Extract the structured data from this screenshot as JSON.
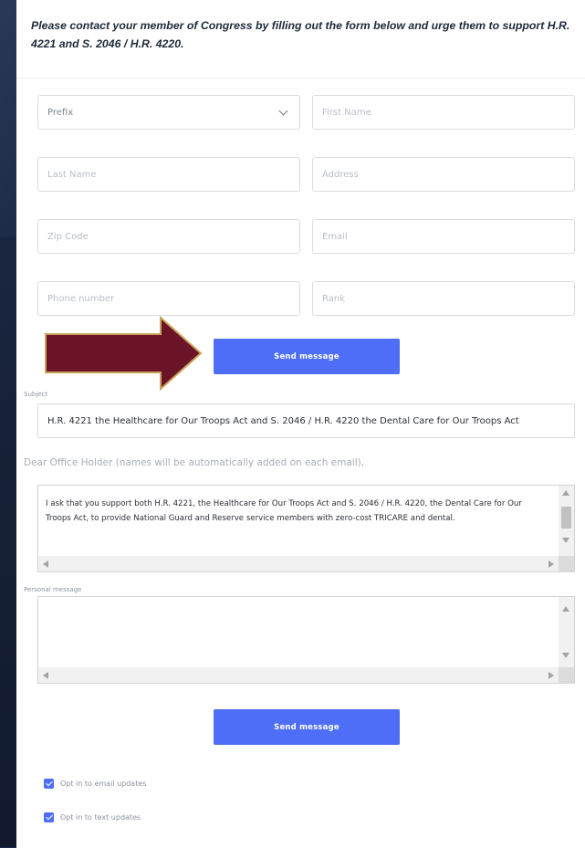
{
  "intro_text": "Please contact your member of Congress by filling out the form below and urge them to support H.R. 4221 and S. 2046 / H.R. 4220.",
  "form": {
    "prefix_placeholder": "Prefix",
    "first_name_placeholder": "First Name",
    "last_name_placeholder": "Last Name",
    "address_placeholder": "Address",
    "zip_placeholder": "Zip Code",
    "email_placeholder": "Email",
    "phone_placeholder": "Phone number",
    "rank_placeholder": "Rank",
    "send_button_top": "Send message",
    "subject_label": "Subject",
    "subject_value": "H.R. 4221 the Healthcare for Our Troops Act and S. 2046 / H.R. 4220 the Dental Care for Our Troops Act",
    "salutation": "Dear Office Holder (names will be automatically added on each email),",
    "message_body": "I ask that you support both H.R. 4221, the Healthcare for Our Troops Act and S. 2046 / H.R. 4220, the Dental Care for Our Troops Act, to provide National Guard and Reserve service members with zero-cost TRICARE and dental.",
    "personal_message_label": "Personal message",
    "personal_message_value": "",
    "send_button_bottom": "Send message",
    "opt_email_label": "Opt in to email updates",
    "opt_email_checked": true,
    "opt_text_label": "Opt in to text updates",
    "opt_text_checked": true
  },
  "colors": {
    "button": "#4f6ef7",
    "arrow_fill": "#6b1428",
    "arrow_stroke": "#c9a25a",
    "background": "#17223a"
  }
}
